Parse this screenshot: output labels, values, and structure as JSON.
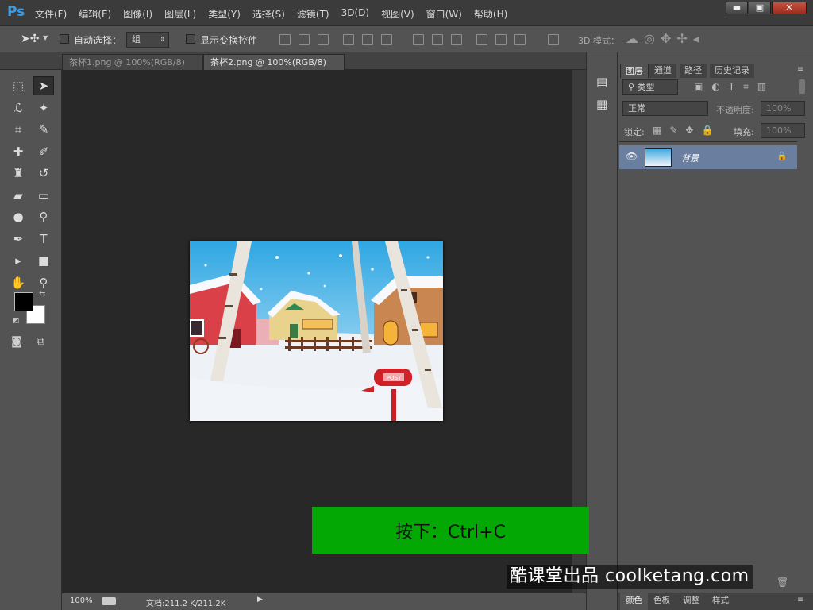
{
  "app": {
    "logo": "Ps"
  },
  "menu": [
    "文件(F)",
    "编辑(E)",
    "图像(I)",
    "图层(L)",
    "类型(Y)",
    "选择(S)",
    "滤镜(T)",
    "3D(D)",
    "视图(V)",
    "窗口(W)",
    "帮助(H)"
  ],
  "window_controls": {
    "minimize": "▬",
    "maximize": "▣",
    "close": "✕"
  },
  "options": {
    "auto_select_label": "自动选择：",
    "auto_select_value": "组",
    "show_transform_label": "显示变换控件",
    "mode_3d_label": "3D 模式："
  },
  "tabs": [
    {
      "label": "茶杯1.png @ 100%(RGB/8)",
      "active": false
    },
    {
      "label": "茶杯2.png @ 100%(RGB/8)",
      "active": true
    }
  ],
  "status": {
    "zoom": "100%",
    "doc": "文档:211.2 K/211.2K"
  },
  "panel": {
    "tabs": [
      "图层",
      "通道",
      "路径",
      "历史记录"
    ],
    "filter_kind": "类型",
    "blend_mode": "正常",
    "opacity_label": "不透明度:",
    "opacity_value": "100%",
    "lock_label": "锁定:",
    "fill_label": "填充:",
    "fill_value": "100%",
    "layer_name": "背景"
  },
  "bottom_tabs": [
    "颜色",
    "色板",
    "调整",
    "样式"
  ],
  "overlay": {
    "banner": "按下：Ctrl+C",
    "watermark": "酷课堂出品 coolketang.com"
  },
  "mailbox_text": "POST",
  "colors": {
    "accent": "#3b9ce6",
    "banner": "#04a804",
    "selected_layer": "#6a7fa0"
  }
}
